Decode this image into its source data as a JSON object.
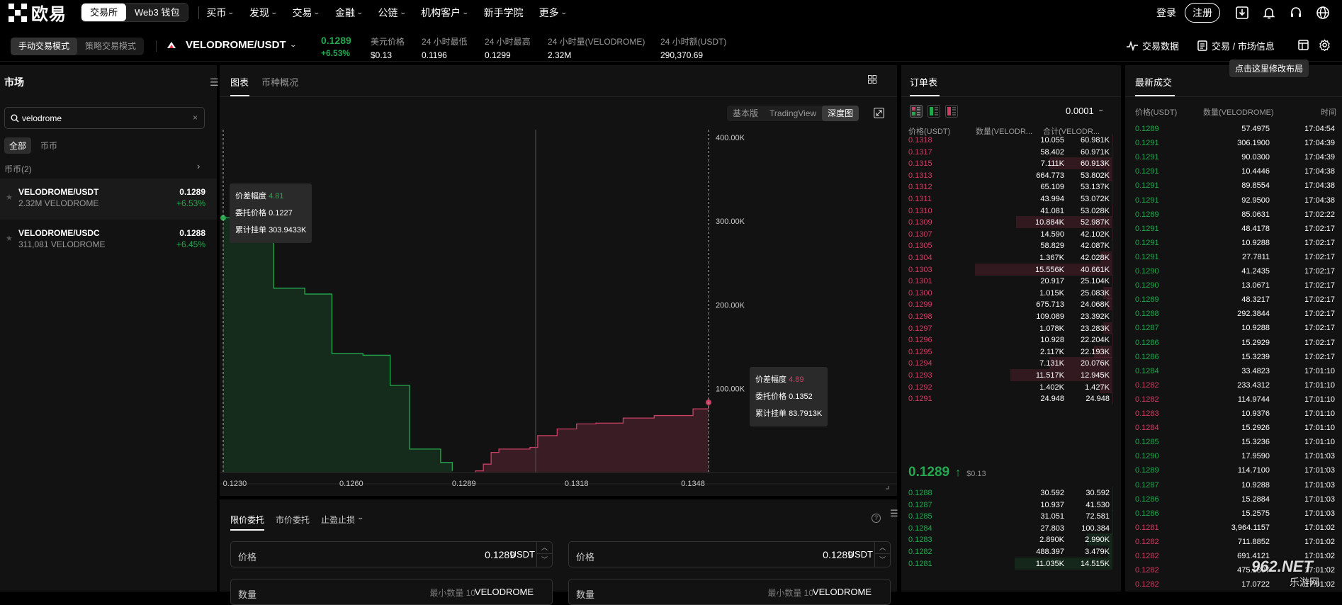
{
  "nav": {
    "brand": "欧易",
    "switch": [
      "交易所",
      "Web3 钱包"
    ],
    "menu": [
      "买币",
      "发现",
      "交易",
      "金融",
      "公链",
      "机构客户",
      "新手学院",
      "更多"
    ],
    "login": "登录",
    "register": "注册"
  },
  "ticker": {
    "modes": [
      "手动交易模式",
      "策略交易模式"
    ],
    "pair": "VELODROME/USDT",
    "last": "0.1289",
    "change": "+6.53%",
    "stats": [
      {
        "label": "美元价格",
        "value": "$0.13"
      },
      {
        "label": "24 小时最低",
        "value": "0.1196"
      },
      {
        "label": "24 小时最高",
        "value": "0.1299"
      },
      {
        "label": "24 小时量(VELODROME)",
        "value": "2.32M"
      },
      {
        "label": "24 小时额(USDT)",
        "value": "290,370.69"
      }
    ],
    "tradedata": "交易数据",
    "marketinfo": "交易 / 市场信息",
    "layout_tip": "点击这里修改布局"
  },
  "market": {
    "title": "市场",
    "search_value": "velodrome",
    "filters": [
      "全部",
      "币币"
    ],
    "group": "币币(2)",
    "rows": [
      {
        "name": "VELODROME/USDT",
        "volume": "2.32M VELODROME",
        "price": "0.1289",
        "change": "+6.53%"
      },
      {
        "name": "VELODROME/USDC",
        "volume": "311,081 VELODROME",
        "price": "0.1288",
        "change": "+6.45%"
      }
    ]
  },
  "chart": {
    "tabs": [
      "图表",
      "币种概况"
    ],
    "modes": [
      "基本版",
      "TradingView",
      "深度图"
    ],
    "tip_bid": {
      "spread_label": "价差幅度",
      "spread": "4.81",
      "price_label": "委托价格",
      "price": "0.1227",
      "sum_label": "累计挂单",
      "sum": "303.9433K"
    },
    "tip_ask": {
      "spread_label": "价差幅度",
      "spread": "4.89",
      "price_label": "委托价格",
      "price": "0.1352",
      "sum_label": "累计挂单",
      "sum": "83.7913K"
    }
  },
  "chart_data": {
    "type": "area",
    "title": "",
    "x_ticks": [
      "0.1230",
      "0.1260",
      "0.1289",
      "0.1318",
      "0.1348"
    ],
    "y_ticks": [
      "100.00K",
      "200.00K",
      "300.00K",
      "400.00K"
    ],
    "xlim": [
      0.1227,
      0.1352
    ],
    "ylim": [
      0,
      405000
    ],
    "series": [
      {
        "side": "bid",
        "color": "#25a750",
        "x": [
          0.1227,
          0.1234,
          0.124,
          0.1248,
          0.1255,
          0.1263,
          0.127,
          0.1272,
          0.1275,
          0.1283,
          0.1286
        ],
        "y": [
          303943,
          303943,
          220000,
          213000,
          142000,
          140000,
          104000,
          104000,
          28000,
          12000,
          2000
        ]
      },
      {
        "side": "ask",
        "color": "#ca3f64",
        "x": [
          0.1292,
          0.1294,
          0.1296,
          0.1298,
          0.1306,
          0.1308,
          0.1313,
          0.1318,
          0.1323,
          0.133,
          0.1338,
          0.1348,
          0.1352
        ],
        "y": [
          2000,
          10000,
          24000,
          28000,
          30000,
          44000,
          52000,
          58000,
          59000,
          65000,
          68000,
          76000,
          83791
        ]
      }
    ]
  },
  "orderbook": {
    "title": "订单表",
    "precision": "0.0001",
    "headers": [
      "价格(USDT)",
      "数量(VELODR...",
      "合计(VELODR..."
    ],
    "asks": [
      [
        "0.1318",
        "10.055",
        "60.981K"
      ],
      [
        "0.1317",
        "58.402",
        "60.971K"
      ],
      [
        "0.1315",
        "7.111K",
        "60.913K"
      ],
      [
        "0.1313",
        "664.773",
        "53.802K"
      ],
      [
        "0.1312",
        "65.109",
        "53.137K"
      ],
      [
        "0.1311",
        "43.994",
        "53.072K"
      ],
      [
        "0.1310",
        "41.081",
        "53.028K"
      ],
      [
        "0.1309",
        "10.884K",
        "52.987K"
      ],
      [
        "0.1307",
        "14.590",
        "42.102K"
      ],
      [
        "0.1305",
        "58.829",
        "42.087K"
      ],
      [
        "0.1304",
        "1.367K",
        "42.028K"
      ],
      [
        "0.1303",
        "15.556K",
        "40.661K"
      ],
      [
        "0.1301",
        "20.917",
        "25.104K"
      ],
      [
        "0.1300",
        "1.015K",
        "25.083K"
      ],
      [
        "0.1299",
        "675.713",
        "24.068K"
      ],
      [
        "0.1298",
        "109.089",
        "23.392K"
      ],
      [
        "0.1297",
        "1.078K",
        "23.283K"
      ],
      [
        "0.1296",
        "10.928",
        "22.204K"
      ],
      [
        "0.1295",
        "2.117K",
        "22.193K"
      ],
      [
        "0.1294",
        "7.131K",
        "20.076K"
      ],
      [
        "0.1293",
        "11.517K",
        "12.945K"
      ],
      [
        "0.1292",
        "1.402K",
        "1.427K"
      ],
      [
        "0.1291",
        "24.948",
        "24.948"
      ]
    ],
    "mid_price": "0.1289",
    "mid_usd": "$0.13",
    "bids": [
      [
        "0.1288",
        "30.592",
        "30.592"
      ],
      [
        "0.1287",
        "10.937",
        "41.530"
      ],
      [
        "0.1285",
        "31.051",
        "72.581"
      ],
      [
        "0.1284",
        "27.803",
        "100.384"
      ],
      [
        "0.1283",
        "2.890K",
        "2.990K"
      ],
      [
        "0.1282",
        "488.397",
        "3.479K"
      ],
      [
        "0.1281",
        "11.035K",
        "14.515K"
      ]
    ]
  },
  "trades": {
    "title": "最新成交",
    "headers": [
      "价格(USDT)",
      "数量(VELODROME)",
      "时间"
    ],
    "rows": [
      [
        "0.1289",
        "57.4975",
        "17:04:54",
        "g"
      ],
      [
        "0.1291",
        "306.1900",
        "17:04:39",
        "g"
      ],
      [
        "0.1291",
        "90.0300",
        "17:04:39",
        "g"
      ],
      [
        "0.1291",
        "10.4446",
        "17:04:38",
        "g"
      ],
      [
        "0.1291",
        "89.8554",
        "17:04:38",
        "g"
      ],
      [
        "0.1291",
        "92.9500",
        "17:04:38",
        "g"
      ],
      [
        "0.1289",
        "85.0631",
        "17:02:22",
        "g"
      ],
      [
        "0.1291",
        "48.4178",
        "17:02:17",
        "g"
      ],
      [
        "0.1291",
        "10.9288",
        "17:02:17",
        "g"
      ],
      [
        "0.1291",
        "27.7811",
        "17:02:17",
        "g"
      ],
      [
        "0.1290",
        "41.2435",
        "17:02:17",
        "g"
      ],
      [
        "0.1290",
        "13.0671",
        "17:02:17",
        "g"
      ],
      [
        "0.1289",
        "48.3217",
        "17:02:17",
        "g"
      ],
      [
        "0.1288",
        "292.3844",
        "17:02:17",
        "g"
      ],
      [
        "0.1287",
        "10.9288",
        "17:02:17",
        "g"
      ],
      [
        "0.1286",
        "15.2929",
        "17:02:17",
        "g"
      ],
      [
        "0.1286",
        "15.3239",
        "17:02:17",
        "g"
      ],
      [
        "0.1284",
        "33.4823",
        "17:01:10",
        "g"
      ],
      [
        "0.1282",
        "233.4312",
        "17:01:10",
        "r"
      ],
      [
        "0.1282",
        "114.9744",
        "17:01:10",
        "r"
      ],
      [
        "0.1283",
        "10.9376",
        "17:01:10",
        "r"
      ],
      [
        "0.1284",
        "15.2926",
        "17:01:10",
        "r"
      ],
      [
        "0.1285",
        "15.3236",
        "17:01:10",
        "g"
      ],
      [
        "0.1290",
        "17.9590",
        "17:01:03",
        "g"
      ],
      [
        "0.1289",
        "114.7100",
        "17:01:03",
        "g"
      ],
      [
        "0.1287",
        "10.9288",
        "17:01:03",
        "g"
      ],
      [
        "0.1286",
        "15.2884",
        "17:01:03",
        "g"
      ],
      [
        "0.1286",
        "15.2575",
        "17:01:03",
        "g"
      ],
      [
        "0.1281",
        "3,964.1157",
        "17:01:02",
        "r"
      ],
      [
        "0.1282",
        "711.8852",
        "17:01:02",
        "r"
      ],
      [
        "0.1282",
        "691.4121",
        "17:01:02",
        "r"
      ],
      [
        "0.1282",
        "475.1807",
        "17:01:02",
        "r"
      ],
      [
        "0.1282",
        "17.0722",
        "17:01:02",
        "r"
      ]
    ]
  },
  "orderform": {
    "tabs": [
      "限价委托",
      "市价委托",
      "止盈止损"
    ],
    "price_label": "价格",
    "price_value": "0.1289",
    "unit": "USDT",
    "qty_label": "数量",
    "qty_placeholder": "最小数量 10",
    "qty_unit": "VELODROME"
  },
  "watermark": {
    "brand": "962.NET",
    "sub": "乐游网"
  }
}
